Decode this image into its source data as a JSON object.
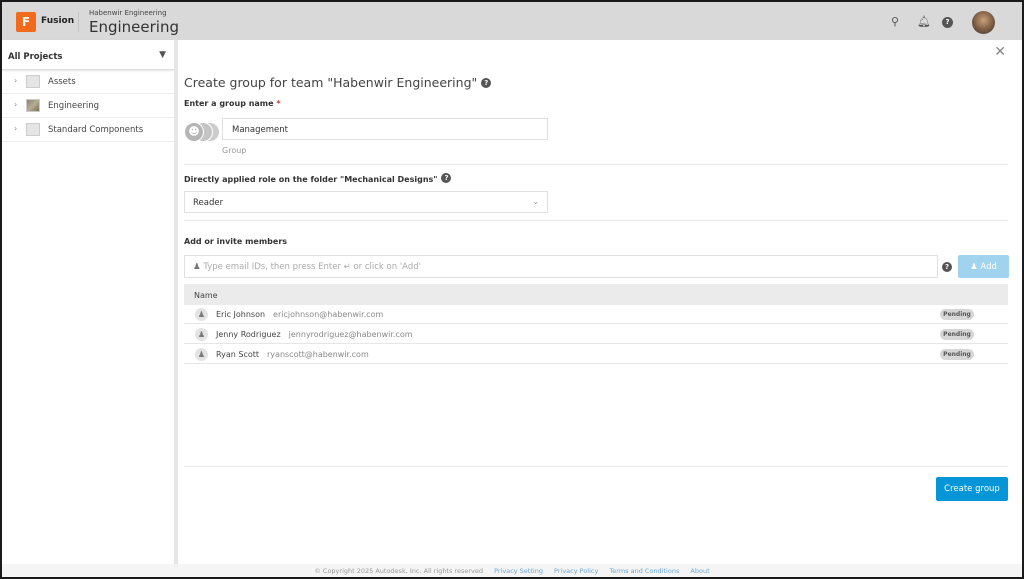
{
  "header": {
    "logo_letter": "F",
    "app_name": "Fusion",
    "team": "Habenwir Engineering",
    "project": "Engineering"
  },
  "sidebar": {
    "title": "All Projects",
    "items": [
      {
        "label": "Assets"
      },
      {
        "label": "Engineering"
      },
      {
        "label": "Standard Components"
      }
    ]
  },
  "dialog": {
    "title": "Create group for team \"Habenwir Engineering\"",
    "group_name_label": "Enter a group name",
    "required_mark": "*",
    "group_name_value": "Management",
    "group_sublabel": "Group",
    "role_label": "Directly applied role on the folder \"Mechanical Designs\"",
    "role_value": "Reader",
    "members_label": "Add or invite members",
    "members_placeholder": "Type email IDs, then press Enter ↵ or click on 'Add'",
    "add_button": "Add",
    "table_header": "Name",
    "members": [
      {
        "name": "Eric Johnson",
        "email": "ericjohnson@habenwir.com",
        "status": "Pending"
      },
      {
        "name": "Jenny Rodriguez",
        "email": "jennyrodriguez@habenwir.com",
        "status": "Pending"
      },
      {
        "name": "Ryan Scott",
        "email": "ryanscott@habenwir.com",
        "status": "Pending"
      }
    ],
    "create_button": "Create group"
  },
  "footer": {
    "copyright": "© Copyright 2025 Autodesk, Inc. All rights reserved",
    "links": [
      "Privacy Setting",
      "Privacy Policy",
      "Terms and Conditions",
      "About"
    ]
  },
  "colors": {
    "accent": "#0696d7",
    "add_disabled": "#9fd3ee",
    "logo": "#f26b1d"
  }
}
